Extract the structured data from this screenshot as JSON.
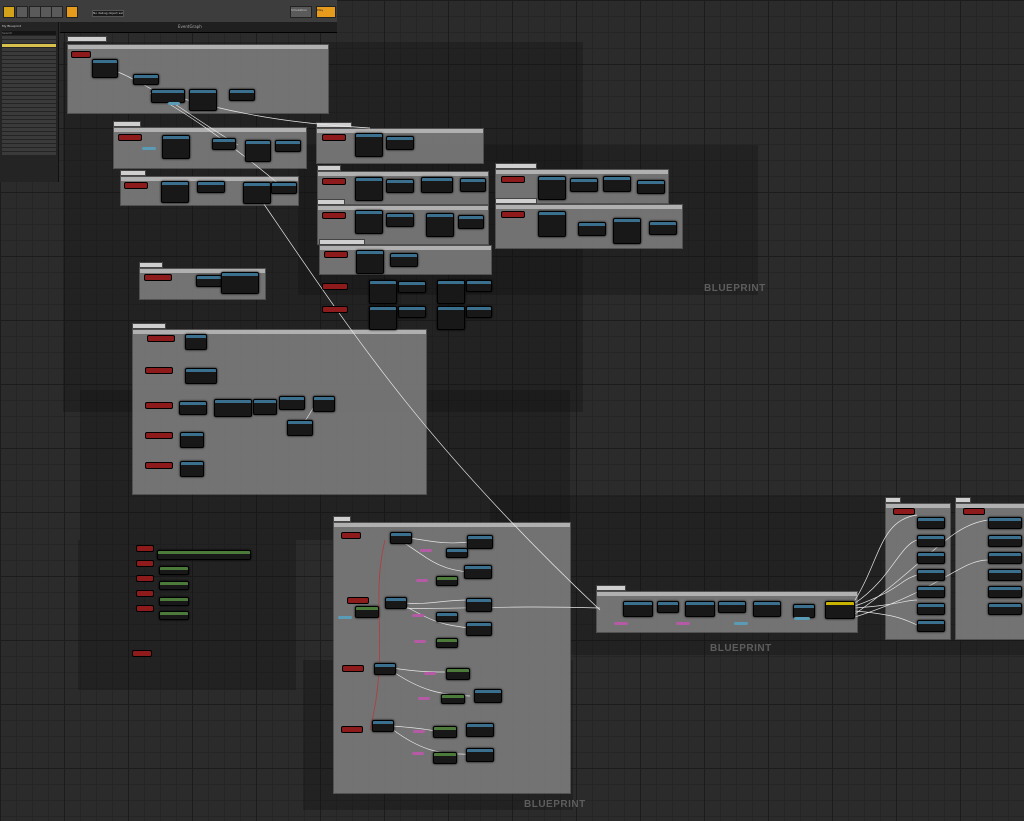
{
  "toolbar": {
    "buttons": [
      "save-icon",
      "browse-icon",
      "compile-icon",
      "settings-icon",
      "defaults-icon",
      "play-icon"
    ],
    "debug_filter": "No debug object selected",
    "simulation": "Simulation",
    "play": "Play"
  },
  "sidebar": {
    "header": "My Blueprint",
    "search_placeholder": "Search"
  },
  "graph_tab": {
    "title": "EventGraph"
  },
  "watermarks": [
    "BLUEPRINT",
    "BLUEPRINT",
    "BLUEPRINT"
  ],
  "colors": {
    "background": "#2b2b2b",
    "comment_box": "#7a7a7a",
    "event_node": "#8d1b1b",
    "function_node": "#3a6f8e",
    "accent": "#e79b1c"
  }
}
